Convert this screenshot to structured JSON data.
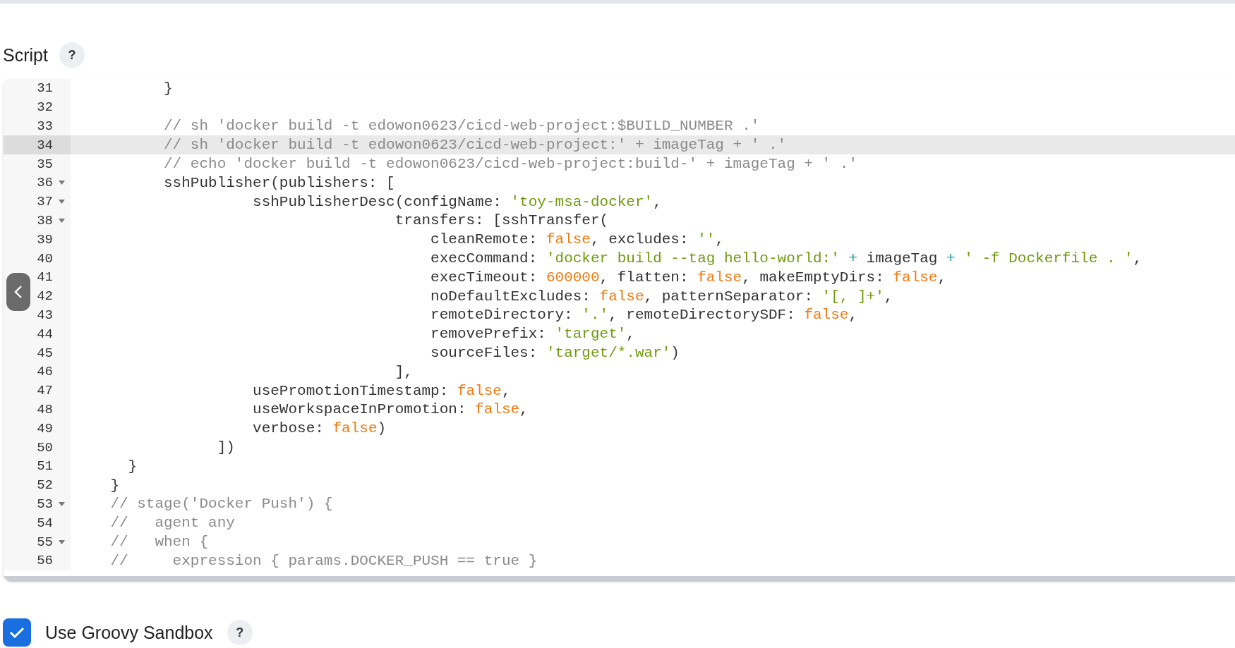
{
  "script_label": "Script",
  "script_help": "?",
  "editor": {
    "lines": [
      {
        "number": "31",
        "foldable": false,
        "active": false,
        "tokens": [
          {
            "kind": "plain",
            "text": "          }"
          }
        ]
      },
      {
        "number": "32",
        "foldable": false,
        "active": false
      },
      {
        "number": "33",
        "foldable": false,
        "active": false,
        "tokens": [
          {
            "kind": "comment",
            "text": "          // sh 'docker build -t edowon0623/cicd-web-project:$BUILD_NUMBER .'"
          }
        ]
      },
      {
        "number": "34",
        "foldable": false,
        "active": true,
        "tokens": [
          {
            "kind": "comment",
            "text": "          // sh 'docker build -t edowon0623/cicd-web-project:' + imageTag + ' .'"
          }
        ]
      },
      {
        "number": "35",
        "foldable": false,
        "active": false,
        "tokens": [
          {
            "kind": "comment",
            "text": "          // echo 'docker build -t edowon0623/cicd-web-project:build-' + imageTag + ' .'"
          }
        ]
      },
      {
        "number": "36",
        "foldable": true,
        "active": false,
        "tokens": [
          {
            "kind": "plain",
            "text": "          sshPublisher(publishers: ["
          }
        ]
      },
      {
        "number": "37",
        "foldable": true,
        "active": false,
        "tokens": [
          {
            "kind": "plain",
            "text": "                    sshPublisherDesc(configName: "
          },
          {
            "kind": "string",
            "text": "'toy-msa-docker'"
          },
          {
            "kind": "plain",
            "text": ","
          }
        ]
      },
      {
        "number": "38",
        "foldable": true,
        "active": false,
        "tokens": [
          {
            "kind": "plain",
            "text": "                                    transfers: [sshTransfer("
          }
        ]
      },
      {
        "number": "39",
        "foldable": false,
        "active": false,
        "tokens": [
          {
            "kind": "plain",
            "text": "                                        cleanRemote: "
          },
          {
            "kind": "literal",
            "text": "false"
          },
          {
            "kind": "plain",
            "text": ", excludes: "
          },
          {
            "kind": "string",
            "text": "''"
          },
          {
            "kind": "plain",
            "text": ","
          }
        ]
      },
      {
        "number": "40",
        "foldable": false,
        "active": false,
        "tokens": [
          {
            "kind": "plain",
            "text": "                                        execCommand: "
          },
          {
            "kind": "string",
            "text": "'docker build --tag hello-world:'"
          },
          {
            "kind": "operator",
            "text": " + "
          },
          {
            "kind": "plain",
            "text": "imageTag"
          },
          {
            "kind": "operator",
            "text": " + "
          },
          {
            "kind": "string",
            "text": "' -f Dockerfile . '"
          },
          {
            "kind": "plain",
            "text": ","
          }
        ]
      },
      {
        "number": "41",
        "foldable": false,
        "active": false,
        "tokens": [
          {
            "kind": "plain",
            "text": "                                        execTimeout: "
          },
          {
            "kind": "literal",
            "text": "600000"
          },
          {
            "kind": "plain",
            "text": ", flatten: "
          },
          {
            "kind": "literal",
            "text": "false"
          },
          {
            "kind": "plain",
            "text": ", makeEmptyDirs: "
          },
          {
            "kind": "literal",
            "text": "false"
          },
          {
            "kind": "plain",
            "text": ","
          }
        ]
      },
      {
        "number": "42",
        "foldable": false,
        "active": false,
        "tokens": [
          {
            "kind": "plain",
            "text": "                                        noDefaultExcludes: "
          },
          {
            "kind": "literal",
            "text": "false"
          },
          {
            "kind": "plain",
            "text": ", patternSeparator: "
          },
          {
            "kind": "string",
            "text": "'[, ]+'"
          },
          {
            "kind": "plain",
            "text": ","
          }
        ]
      },
      {
        "number": "43",
        "foldable": false,
        "active": false,
        "tokens": [
          {
            "kind": "plain",
            "text": "                                        remoteDirectory: "
          },
          {
            "kind": "string",
            "text": "'.'"
          },
          {
            "kind": "plain",
            "text": ", remoteDirectorySDF: "
          },
          {
            "kind": "literal",
            "text": "false"
          },
          {
            "kind": "plain",
            "text": ","
          }
        ]
      },
      {
        "number": "44",
        "foldable": false,
        "active": false,
        "tokens": [
          {
            "kind": "plain",
            "text": "                                        removePrefix: "
          },
          {
            "kind": "string",
            "text": "'target'"
          },
          {
            "kind": "plain",
            "text": ","
          }
        ]
      },
      {
        "number": "45",
        "foldable": false,
        "active": false,
        "tokens": [
          {
            "kind": "plain",
            "text": "                                        sourceFiles: "
          },
          {
            "kind": "string",
            "text": "'target/*.war'"
          },
          {
            "kind": "plain",
            "text": ")"
          }
        ]
      },
      {
        "number": "46",
        "foldable": false,
        "active": false,
        "tokens": [
          {
            "kind": "plain",
            "text": "                                    ],"
          }
        ]
      },
      {
        "number": "47",
        "foldable": false,
        "active": false,
        "tokens": [
          {
            "kind": "plain",
            "text": "                    usePromotionTimestamp: "
          },
          {
            "kind": "literal",
            "text": "false"
          },
          {
            "kind": "plain",
            "text": ","
          }
        ]
      },
      {
        "number": "48",
        "foldable": false,
        "active": false,
        "tokens": [
          {
            "kind": "plain",
            "text": "                    useWorkspaceInPromotion: "
          },
          {
            "kind": "literal",
            "text": "false"
          },
          {
            "kind": "plain",
            "text": ","
          }
        ]
      },
      {
        "number": "49",
        "foldable": false,
        "active": false,
        "tokens": [
          {
            "kind": "plain",
            "text": "                    verbose: "
          },
          {
            "kind": "literal",
            "text": "false"
          },
          {
            "kind": "plain",
            "text": ")"
          }
        ]
      },
      {
        "number": "50",
        "foldable": false,
        "active": false,
        "tokens": [
          {
            "kind": "plain",
            "text": "                ])"
          }
        ]
      },
      {
        "number": "51",
        "foldable": false,
        "active": false,
        "tokens": [
          {
            "kind": "plain",
            "text": "      }"
          }
        ]
      },
      {
        "number": "52",
        "foldable": false,
        "active": false,
        "tokens": [
          {
            "kind": "plain",
            "text": "    }"
          }
        ]
      },
      {
        "number": "53",
        "foldable": true,
        "active": false,
        "tokens": [
          {
            "kind": "comment",
            "text": "    // stage('Docker Push') {"
          }
        ]
      },
      {
        "number": "54",
        "foldable": false,
        "active": false,
        "tokens": [
          {
            "kind": "comment",
            "text": "    //   agent any"
          }
        ]
      },
      {
        "number": "55",
        "foldable": true,
        "active": false,
        "tokens": [
          {
            "kind": "comment",
            "text": "    //   when {"
          }
        ]
      },
      {
        "number": "56",
        "foldable": false,
        "active": false,
        "tokens": [
          {
            "kind": "comment",
            "text": "    //     expression { params.DOCKER_PUSH == true }"
          }
        ]
      }
    ]
  },
  "sandbox": {
    "label": "Use Groovy Sandbox",
    "checked": true,
    "help": "?"
  }
}
